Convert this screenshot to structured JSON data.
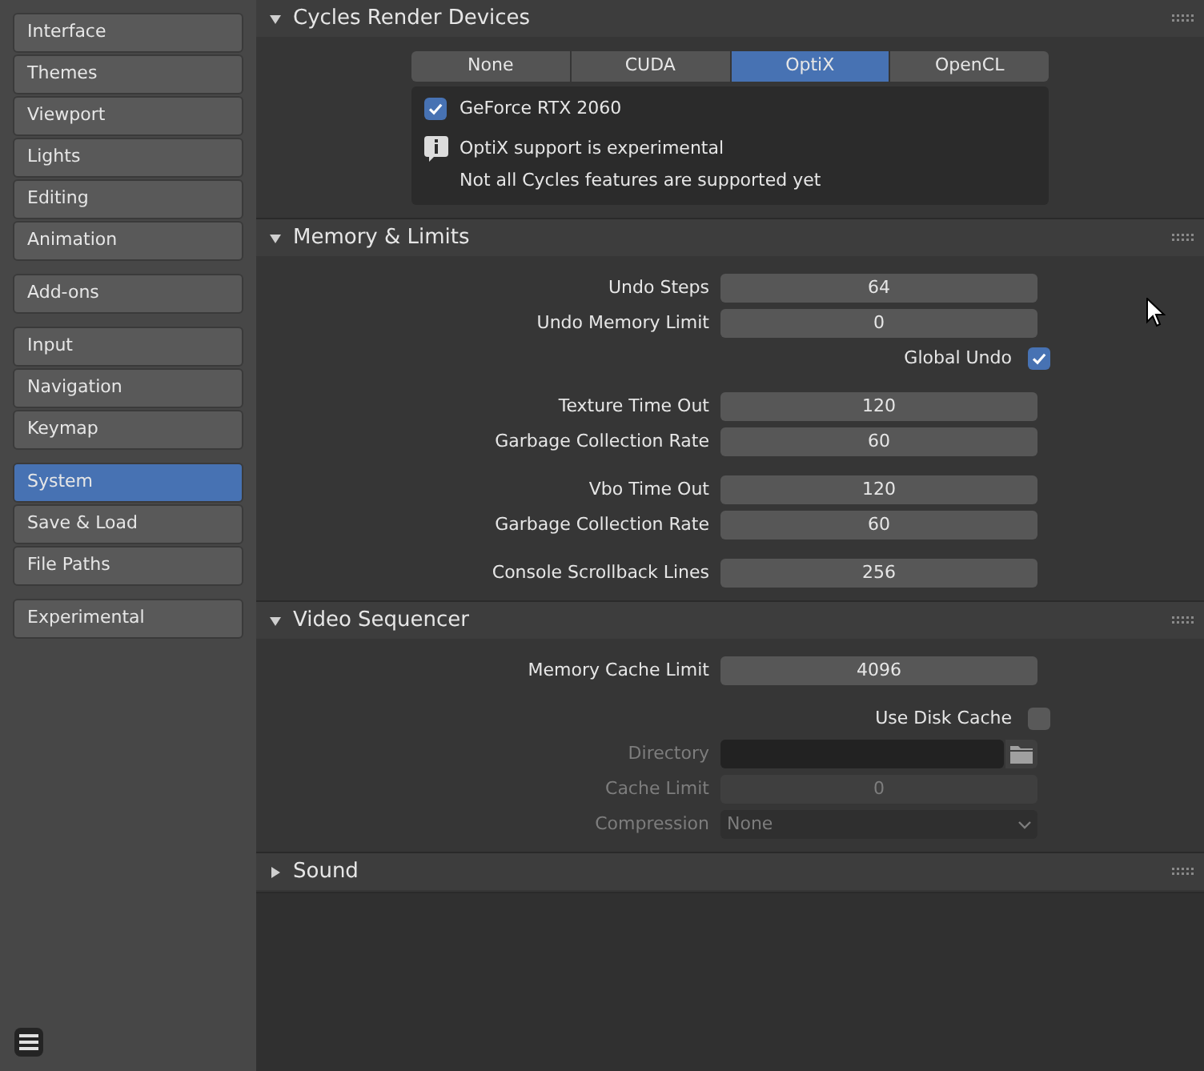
{
  "sidebar": {
    "groups": [
      [
        {
          "label": "Interface",
          "selected": false
        },
        {
          "label": "Themes",
          "selected": false
        },
        {
          "label": "Viewport",
          "selected": false
        },
        {
          "label": "Lights",
          "selected": false
        },
        {
          "label": "Editing",
          "selected": false
        },
        {
          "label": "Animation",
          "selected": false
        }
      ],
      [
        {
          "label": "Add-ons",
          "selected": false
        }
      ],
      [
        {
          "label": "Input",
          "selected": false
        },
        {
          "label": "Navigation",
          "selected": false
        },
        {
          "label": "Keymap",
          "selected": false
        }
      ],
      [
        {
          "label": "System",
          "selected": true
        },
        {
          "label": "Save & Load",
          "selected": false
        },
        {
          "label": "File Paths",
          "selected": false
        }
      ],
      [
        {
          "label": "Experimental",
          "selected": false
        }
      ]
    ]
  },
  "sections": [
    {
      "title": "Cycles Render Devices",
      "expanded": true,
      "kind": "devices",
      "tabs": [
        {
          "label": "None",
          "selected": false
        },
        {
          "label": "CUDA",
          "selected": false
        },
        {
          "label": "OptiX",
          "selected": true
        },
        {
          "label": "OpenCL",
          "selected": false
        }
      ],
      "devices": [
        {
          "name": "GeForce RTX 2060",
          "checked": true
        }
      ],
      "info": [
        "OptiX support is experimental",
        "Not all Cycles features are supported yet"
      ]
    },
    {
      "title": "Memory & Limits",
      "expanded": true,
      "kind": "settings",
      "groups": [
        [
          {
            "kind": "number",
            "label": "Undo Steps",
            "value": "64",
            "disabled": false
          },
          {
            "kind": "number",
            "label": "Undo Memory Limit",
            "value": "0",
            "disabled": false
          },
          {
            "kind": "checkbox",
            "label": "Global Undo",
            "checked": true,
            "disabled": false
          }
        ],
        [
          {
            "kind": "number",
            "label": "Texture Time Out",
            "value": "120",
            "disabled": false
          },
          {
            "kind": "number",
            "label": "Garbage Collection Rate",
            "value": "60",
            "disabled": false
          }
        ],
        [
          {
            "kind": "number",
            "label": "Vbo Time Out",
            "value": "120",
            "disabled": false
          },
          {
            "kind": "number",
            "label": "Garbage Collection Rate",
            "value": "60",
            "disabled": false
          }
        ],
        [
          {
            "kind": "number",
            "label": "Console Scrollback Lines",
            "value": "256",
            "disabled": false
          }
        ]
      ]
    },
    {
      "title": "Video Sequencer",
      "expanded": true,
      "kind": "settings",
      "groups": [
        [
          {
            "kind": "number",
            "label": "Memory Cache Limit",
            "value": "4096",
            "disabled": false
          }
        ],
        [
          {
            "kind": "checkbox",
            "label": "Use Disk Cache",
            "checked": false,
            "disabled": false
          },
          {
            "kind": "path",
            "label": "Directory",
            "disabled": true
          },
          {
            "kind": "number",
            "label": "Cache Limit",
            "value": "0",
            "disabled": true
          },
          {
            "kind": "dropdown",
            "label": "Compression",
            "value": "None",
            "disabled": true
          }
        ]
      ]
    },
    {
      "title": "Sound",
      "expanded": false
    }
  ]
}
